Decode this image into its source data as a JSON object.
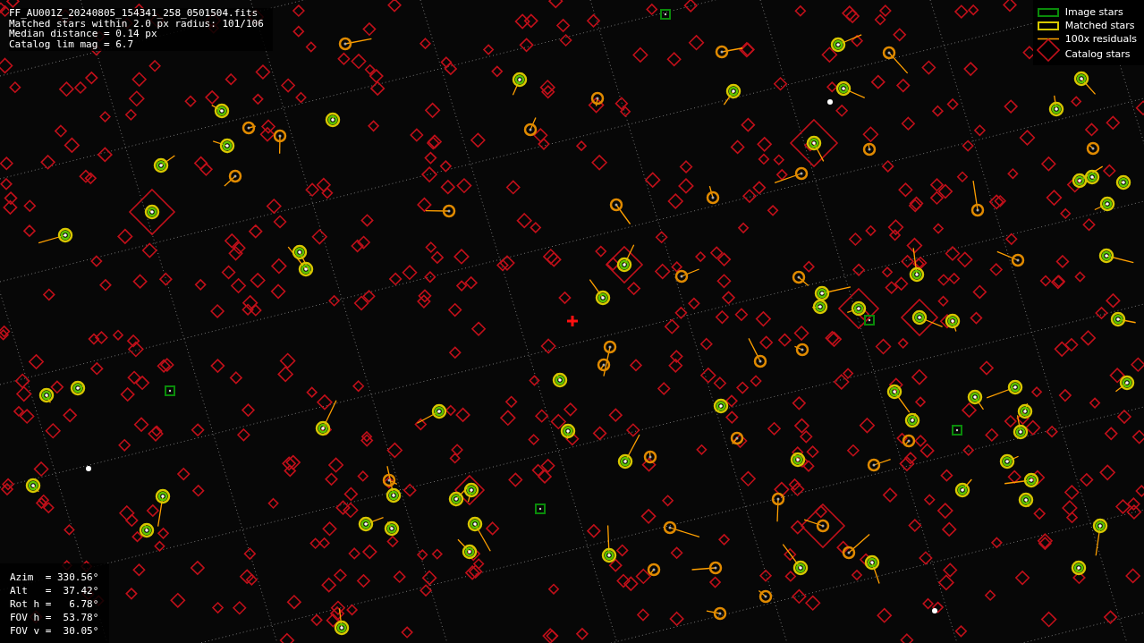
{
  "info": {
    "lines": [
      "FF_AU001Z_20240805_154341_258_0501504.fits",
      "Matched stars within 2.0 px radius: 101/106",
      "Median distance = 0.14 px",
      "Catalog lim mag = 6.7"
    ]
  },
  "legend": [
    {
      "kind": "image",
      "label": "Image stars"
    },
    {
      "kind": "matched",
      "label": "Matched stars"
    },
    {
      "kind": "residual",
      "label": "100x residuals"
    },
    {
      "kind": "catalog",
      "label": "Catalog stars"
    }
  ],
  "pointing": {
    "lines": [
      "Azim  = 330.56°",
      "Alt   =  37.42°",
      "Rot h =   6.78°",
      "FOV h =  53.78°",
      "FOV v =  30.05°"
    ]
  }
}
